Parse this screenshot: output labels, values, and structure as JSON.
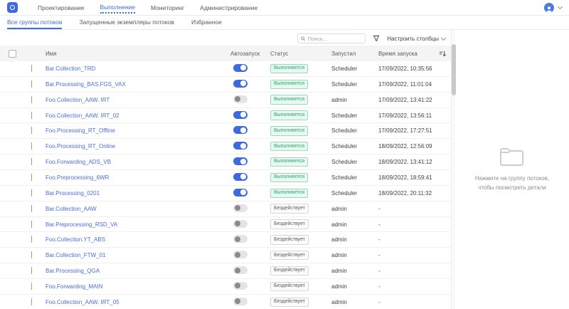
{
  "nav": {
    "items": [
      {
        "label": "Проектирование",
        "active": false
      },
      {
        "label": "Выполнение",
        "active": true
      },
      {
        "label": "Мониторинг",
        "active": false
      },
      {
        "label": "Администрирование",
        "active": false
      }
    ]
  },
  "tabs": [
    {
      "label": "Все группы потоков",
      "active": true
    },
    {
      "label": "Запущенные экземпляры потоков",
      "active": false
    },
    {
      "label": "Избранное",
      "active": false
    }
  ],
  "toolbar": {
    "search_placeholder": "Поиск...",
    "configure_columns_label": "Настроить столбцы"
  },
  "table": {
    "columns": {
      "name": "Имя",
      "autostart": "Автозапуск",
      "status": "Статус",
      "started_by": "Запустил",
      "start_time": "Время запуска"
    },
    "status_labels": {
      "running": "Выполняется",
      "idle": "Бездействует"
    },
    "rows": [
      {
        "name": "Bar.Collection_TRD",
        "autostart": true,
        "status": "running",
        "started_by": "Scheduler",
        "start_time": "17/09/2022, 10:35:56"
      },
      {
        "name": "Bar.Processing_BAS.FGS_VAX",
        "autostart": true,
        "status": "running",
        "started_by": "Scheduler",
        "start_time": "17/09/2022, 11:01:04"
      },
      {
        "name": "Foo.Collection_AAW. IRT",
        "autostart": false,
        "status": "running",
        "started_by": "admin",
        "start_time": "17/09/2022, 13:41:22"
      },
      {
        "name": "Foo.Collection_AAW. IRT_02",
        "autostart": true,
        "status": "running",
        "started_by": "Scheduler",
        "start_time": "17/09/2022, 13:56:11"
      },
      {
        "name": "Foo.Processing_RT_Offline",
        "autostart": true,
        "status": "running",
        "started_by": "Scheduler",
        "start_time": "17/09/2022, 17:27:51"
      },
      {
        "name": "Foo.Processing_RT_Online",
        "autostart": true,
        "status": "running",
        "started_by": "Scheduler",
        "start_time": "18/09/2022, 12:56:09"
      },
      {
        "name": "Foo.Forwarding_ADS_VB",
        "autostart": true,
        "status": "running",
        "started_by": "Scheduler",
        "start_time": "18/09/2022, 13:41:12"
      },
      {
        "name": "Foo.Preprocessing_6WR",
        "autostart": true,
        "status": "running",
        "started_by": "Scheduler",
        "start_time": "18/09/2022, 18:59:41"
      },
      {
        "name": "Bar.Processing_0201",
        "autostart": true,
        "status": "running",
        "started_by": "Scheduler",
        "start_time": "18/09/2022, 20:11:32"
      },
      {
        "name": "Bar.Collection_AAW",
        "autostart": false,
        "status": "idle",
        "started_by": "admin",
        "start_time": "-"
      },
      {
        "name": "Bar.Preprocessing_RSD_VA",
        "autostart": false,
        "status": "idle",
        "started_by": "admin",
        "start_time": "-"
      },
      {
        "name": "Foo.Collection.YT_ABS",
        "autostart": false,
        "status": "idle",
        "started_by": "admin",
        "start_time": "-"
      },
      {
        "name": "Bar.Collection_FTW_01",
        "autostart": false,
        "status": "idle",
        "started_by": "admin",
        "start_time": "-"
      },
      {
        "name": "Bar.Processing_QGA",
        "autostart": false,
        "status": "idle",
        "started_by": "admin",
        "start_time": "-"
      },
      {
        "name": "Foo.Forwarding_MAIN",
        "autostart": false,
        "status": "idle",
        "started_by": "admin",
        "start_time": "-"
      },
      {
        "name": "Foo.Collection_AAW. IRT_05",
        "autostart": false,
        "status": "idle",
        "started_by": "admin",
        "start_time": "-"
      }
    ]
  },
  "detail_panel": {
    "message_line1": "Нажмите на группу потоков,",
    "message_line2": "чтобы посмотреть детали"
  },
  "colors": {
    "accent_blue": "#3d6bdd",
    "link_blue": "#4a6fdb",
    "status_running_text": "#26a872",
    "status_running_bg": "#e9f8f0",
    "status_idle_text": "#595959",
    "header_bg": "#f4f4f4"
  }
}
